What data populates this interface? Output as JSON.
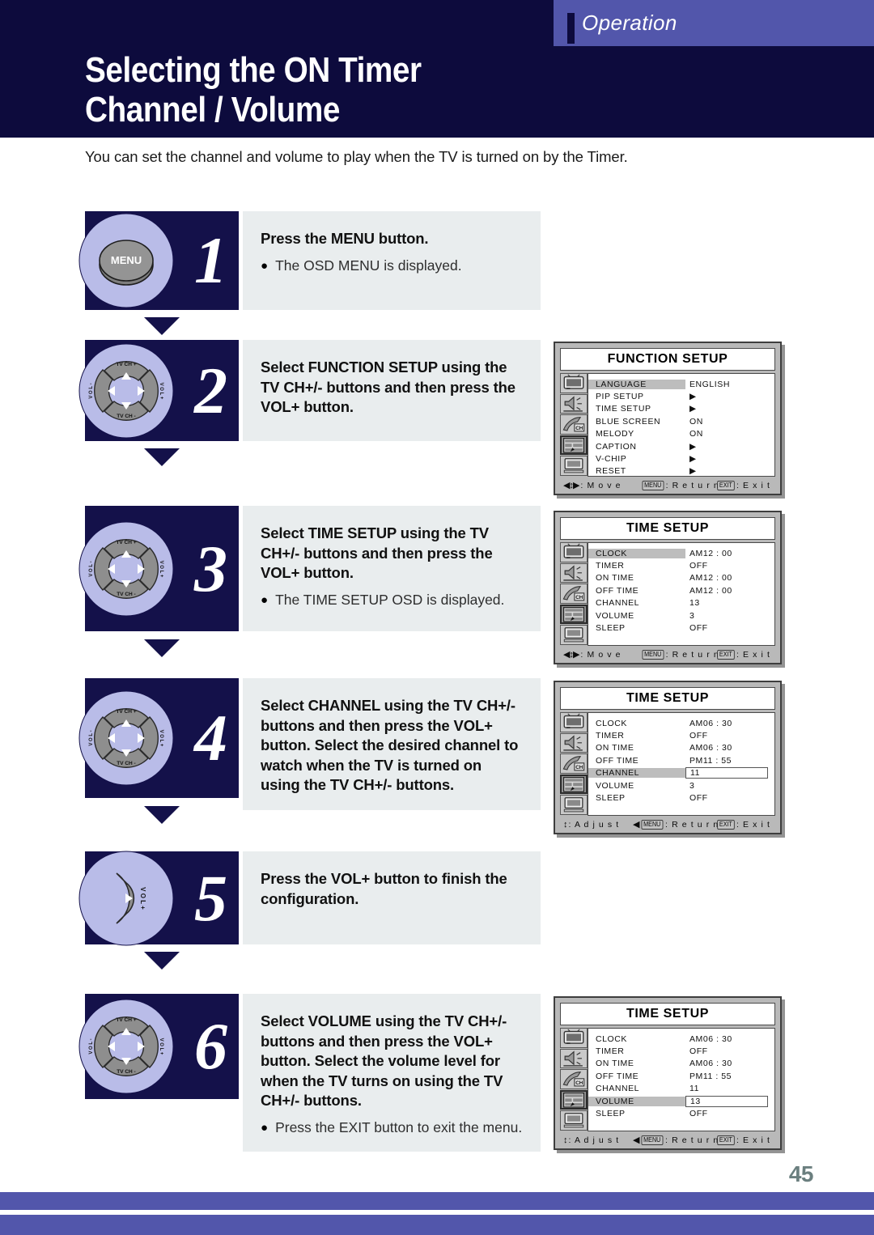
{
  "header": {
    "section_tab": "Operation",
    "title_line1": "Selecting the ON Timer",
    "title_line2": "Channel / Volume"
  },
  "intro": "You can set the channel and volume to play when the TV is turned on by the Timer.",
  "page_number": "45",
  "colors": {
    "header_navy": "#0d0b3d",
    "accent_purple": "#5256ab",
    "badge_navy": "#14114a",
    "knob_lavender": "#b9bce8",
    "text_panel_gray": "#e9edee"
  },
  "steps": [
    {
      "number": "1",
      "knob": "menu-button",
      "knob_label": "MENU",
      "heading": "Press the MENU button.",
      "bullet": "The OSD MENU is displayed."
    },
    {
      "number": "2",
      "knob": "dpad",
      "heading": "Select FUNCTION SETUP using the TV CH+/- buttons and then press the VOL+ button.",
      "bullet": ""
    },
    {
      "number": "3",
      "knob": "dpad",
      "heading": "Select TIME SETUP using the TV CH+/- buttons and then press the VOL+ button.",
      "bullet": "The TIME SETUP OSD is displayed."
    },
    {
      "number": "4",
      "knob": "dpad",
      "heading": "Select CHANNEL using the TV CH+/- buttons and then press the VOL+ button. Select the desired channel to watch when the TV is turned on using the TV CH+/- buttons.",
      "bullet": ""
    },
    {
      "number": "5",
      "knob": "vol-plus",
      "heading": "Press the VOL+ button to finish the configuration.",
      "bullet": ""
    },
    {
      "number": "6",
      "knob": "dpad",
      "heading": "Select VOLUME using the TV CH+/- buttons and then press the VOL+ button. Select the volume level for when the TV turns on using the TV CH+/- buttons.",
      "bullet": "Press the EXIT button to exit the menu."
    }
  ],
  "dpad_labels": {
    "up": "TV CH +",
    "down": "TV CH -",
    "left": "V O L -",
    "right": "V O L +"
  },
  "vol_knob_labels": {
    "right": "V O L +"
  },
  "osd_panels": [
    {
      "id": "function-setup",
      "title": "FUNCTION SETUP",
      "selected_icon_index": 3,
      "rows": [
        {
          "label": "LANGUAGE",
          "value": "ENGLISH",
          "highlight": true,
          "boxed": false
        },
        {
          "label": "PIP SETUP",
          "value": "▶",
          "highlight": false,
          "boxed": false
        },
        {
          "label": "TIME SETUP",
          "value": "▶",
          "highlight": false,
          "boxed": false
        },
        {
          "label": "BLUE SCREEN",
          "value": "ON",
          "highlight": false,
          "boxed": false
        },
        {
          "label": "MELODY",
          "value": "ON",
          "highlight": false,
          "boxed": false
        },
        {
          "label": "CAPTION",
          "value": "▶",
          "highlight": false,
          "boxed": false
        },
        {
          "label": "V-CHIP",
          "value": "▶",
          "highlight": false,
          "boxed": false
        },
        {
          "label": "RESET",
          "value": "▶",
          "highlight": false,
          "boxed": false
        }
      ],
      "footer": {
        "nav_glyph": "◀↕▶",
        "nav_label": ": M o v e",
        "return_key": "MENU",
        "return_label": ": R e t u r n",
        "exit_key": "EXIT",
        "exit_label": ": E x i t",
        "return_prefix": ""
      }
    },
    {
      "id": "time-setup-1",
      "title": "TIME SETUP",
      "selected_icon_index": 3,
      "rows": [
        {
          "label": "CLOCK",
          "value": "AM12 : 00",
          "highlight": true,
          "boxed": false
        },
        {
          "label": "TIMER",
          "value": "OFF",
          "highlight": false,
          "boxed": false
        },
        {
          "label": "ON TIME",
          "value": "AM12 : 00",
          "highlight": false,
          "boxed": false
        },
        {
          "label": "OFF TIME",
          "value": "AM12 : 00",
          "highlight": false,
          "boxed": false
        },
        {
          "label": "CHANNEL",
          "value": "13",
          "highlight": false,
          "boxed": false
        },
        {
          "label": "VOLUME",
          "value": "3",
          "highlight": false,
          "boxed": false
        },
        {
          "label": "SLEEP",
          "value": "OFF",
          "highlight": false,
          "boxed": false
        }
      ],
      "footer": {
        "nav_glyph": "◀↕▶",
        "nav_label": ": M o v e",
        "return_key": "MENU",
        "return_label": ": R e t u r n",
        "exit_key": "EXIT",
        "exit_label": ": E x i t",
        "return_prefix": ""
      }
    },
    {
      "id": "time-setup-channel",
      "title": "TIME SETUP",
      "selected_icon_index": 3,
      "rows": [
        {
          "label": "CLOCK",
          "value": "AM06 : 30",
          "highlight": false,
          "boxed": false
        },
        {
          "label": "TIMER",
          "value": "OFF",
          "highlight": false,
          "boxed": false
        },
        {
          "label": "ON TIME",
          "value": "AM06 : 30",
          "highlight": false,
          "boxed": false
        },
        {
          "label": "OFF TIME",
          "value": "PM11 : 55",
          "highlight": false,
          "boxed": false
        },
        {
          "label": "CHANNEL",
          "value": "11",
          "highlight": true,
          "boxed": true
        },
        {
          "label": "VOLUME",
          "value": "3",
          "highlight": false,
          "boxed": false
        },
        {
          "label": "SLEEP",
          "value": "OFF",
          "highlight": false,
          "boxed": false
        }
      ],
      "footer": {
        "nav_glyph": "↕",
        "nav_label": ": A d j u s t",
        "return_key": "MENU",
        "return_label": ": R e t u r n",
        "exit_key": "EXIT",
        "exit_label": ": E x i t",
        "return_prefix": "◀"
      }
    },
    {
      "id": "time-setup-volume",
      "title": "TIME SETUP",
      "selected_icon_index": 3,
      "rows": [
        {
          "label": "CLOCK",
          "value": "AM06 : 30",
          "highlight": false,
          "boxed": false
        },
        {
          "label": "TIMER",
          "value": "OFF",
          "highlight": false,
          "boxed": false
        },
        {
          "label": "ON TIME",
          "value": "AM06 : 30",
          "highlight": false,
          "boxed": false
        },
        {
          "label": "OFF TIME",
          "value": "PM11 : 55",
          "highlight": false,
          "boxed": false
        },
        {
          "label": "CHANNEL",
          "value": "11",
          "highlight": false,
          "boxed": false
        },
        {
          "label": "VOLUME",
          "value": "13",
          "highlight": true,
          "boxed": true
        },
        {
          "label": "SLEEP",
          "value": "OFF",
          "highlight": false,
          "boxed": false
        }
      ],
      "footer": {
        "nav_glyph": "↕",
        "nav_label": ": A d j u s t",
        "return_key": "MENU",
        "return_label": ": R e t u r n",
        "exit_key": "EXIT",
        "exit_label": ": E x i t",
        "return_prefix": "◀"
      }
    }
  ],
  "osd_icon_names": [
    "tv-picture-icon",
    "speaker-sound-icon",
    "antenna-channel-icon",
    "function-setup-icon",
    "monitor-special-icon"
  ]
}
